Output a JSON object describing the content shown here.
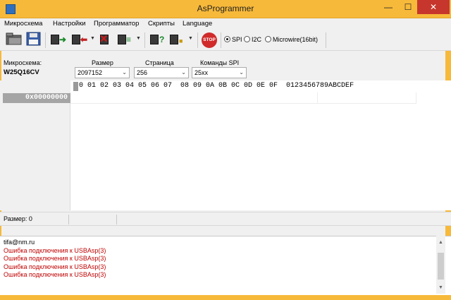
{
  "window": {
    "title": "AsProgrammer",
    "minimize": "—",
    "maximize": "☐",
    "close": "✕"
  },
  "menu": [
    "Микросхема",
    "Настройки",
    "Программатор",
    "Скрипты",
    "Language"
  ],
  "toolbar": {
    "stop_label": "STOP",
    "interfaces": [
      {
        "label": "SPI",
        "selected": true
      },
      {
        "label": "I2C",
        "selected": false
      },
      {
        "label": "Microwire(16bit)",
        "selected": false
      }
    ]
  },
  "chip": {
    "label": "Микросхема:",
    "name": "W25Q16CV"
  },
  "size": {
    "label": "Размер",
    "value": "2097152"
  },
  "page": {
    "label": "Страница",
    "value": "256"
  },
  "spi_commands": {
    "label": "Команды SPI",
    "value": "25xx"
  },
  "hex": {
    "header": "0 01 02 03 04 05 06 07  08 09 0A 0B 0C 0D 0E 0F  0123456789ABCDEF",
    "address": "0x00000000"
  },
  "status": {
    "size": "Размер: 0"
  },
  "log": {
    "lines": [
      {
        "text": "tifa@nm.ru",
        "color": "#000000"
      },
      {
        "text": "Ошибка подключения к USBAsp(3)",
        "color": "#c00000"
      },
      {
        "text": "Ошибка подключения к USBAsp(3)",
        "color": "#c00000"
      },
      {
        "text": "Ошибка подключения к USBAsp(3)",
        "color": "#c00000"
      },
      {
        "text": "Ошибка подключения к USBAsp(3)",
        "color": "#c00000"
      }
    ]
  }
}
